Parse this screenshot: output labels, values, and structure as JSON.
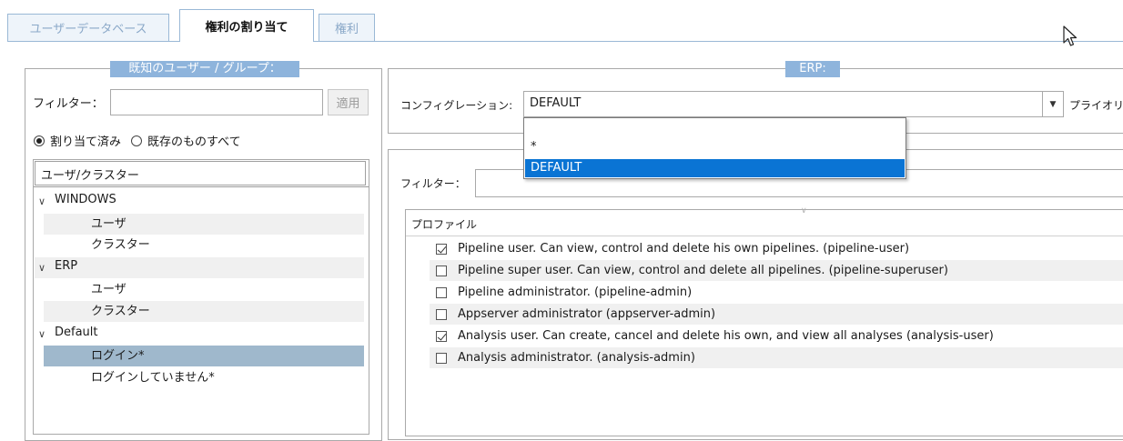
{
  "tabs": [
    {
      "label": "ユーザーデータベース",
      "active": false
    },
    {
      "label": "権利の割り当て",
      "active": true
    },
    {
      "label": "権利",
      "active": false
    }
  ],
  "left_panel": {
    "legend": "既知のユーザー / グループ：",
    "filter_label": "フィルター：",
    "filter_value": "",
    "apply_button": "適用",
    "radio_assigned": "割り当て済み",
    "radio_all": "既存のものすべて",
    "radio_selected": "assigned",
    "tree_header": "ユーザ/クラスター",
    "tree": [
      {
        "label": "WINDOWS",
        "level": 0,
        "expanded": true
      },
      {
        "label": "ユーザ",
        "level": 1
      },
      {
        "label": "クラスター",
        "level": 1
      },
      {
        "label": "ERP",
        "level": 0,
        "expanded": true
      },
      {
        "label": "ユーザ",
        "level": 1
      },
      {
        "label": "クラスター",
        "level": 1
      },
      {
        "label": "Default",
        "level": 0,
        "expanded": true
      },
      {
        "label": "ログイン*",
        "level": 1,
        "selected": true
      },
      {
        "label": "ログインしていません*",
        "level": 1
      }
    ]
  },
  "right_panel": {
    "legend": "ERP:",
    "config_label": "コンフィグレーション:",
    "config_value": "DEFAULT",
    "priority_label": "プライオリテ",
    "dropdown_options": [
      {
        "label": "*",
        "selected": false
      },
      {
        "label": "DEFAULT",
        "selected": true
      }
    ],
    "filter_label": "フィルター：",
    "filter_value": "",
    "profile_header": "プロファイル",
    "profiles": [
      {
        "label": "Pipeline user. Can view, control and delete his own pipelines. (pipeline-user)",
        "checked": true
      },
      {
        "label": "Pipeline super user. Can view, control and delete all pipelines. (pipeline-superuser)",
        "checked": false
      },
      {
        "label": "Pipeline administrator. (pipeline-admin)",
        "checked": false
      },
      {
        "label": "Appserver administrator (appserver-admin)",
        "checked": false
      },
      {
        "label": "Analysis user. Can create, cancel and delete his own, and view all analyses (analysis-user)",
        "checked": true
      },
      {
        "label": "Analysis administrator. (analysis-admin)",
        "checked": false
      }
    ]
  },
  "colors": {
    "legend_bg": "#8eb4dc",
    "selection_bg": "#0a74d4",
    "tree_selected_bg": "#9fb8cc",
    "tab_border": "#9ab8d6"
  }
}
